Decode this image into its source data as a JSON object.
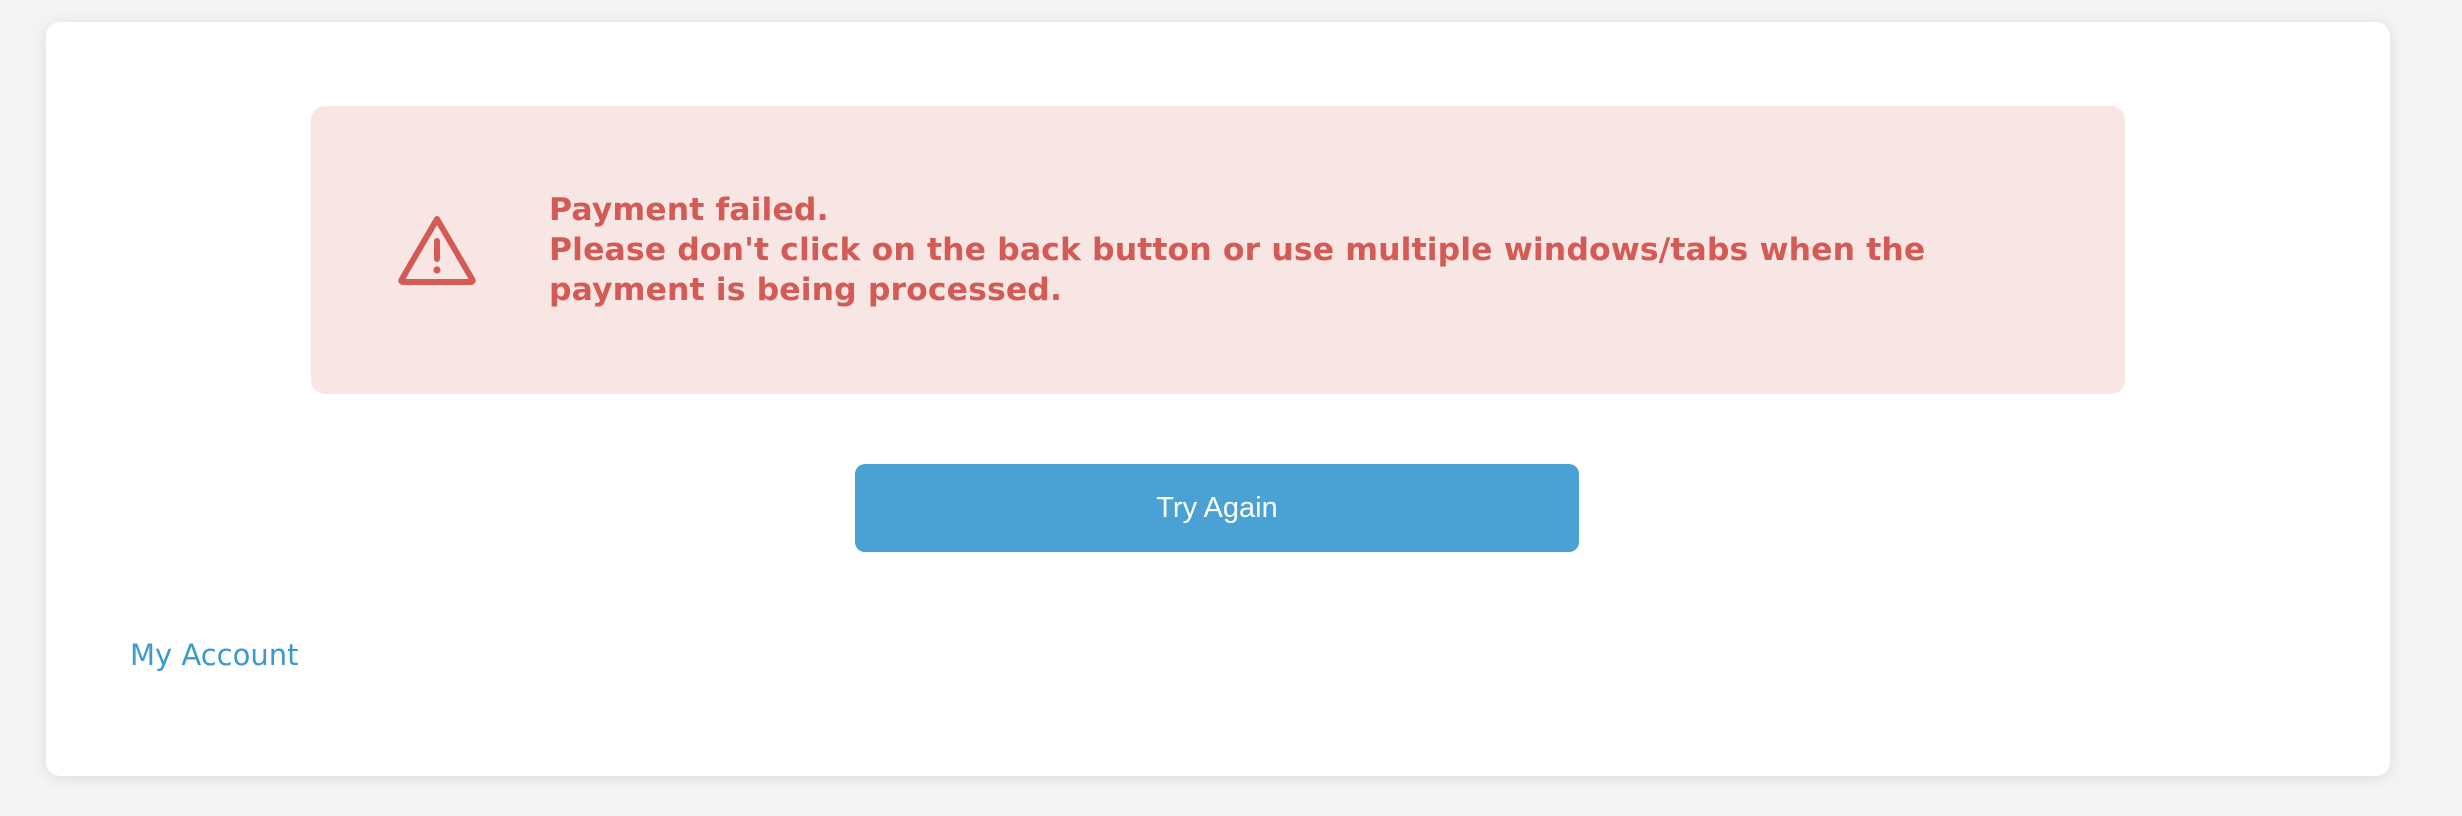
{
  "alert": {
    "icon": "warning-triangle-icon",
    "title": "Payment failed.",
    "message": "Please don't click on the back button or use multiple windows/tabs when the payment is being processed.",
    "background_color": "#f8e6e4",
    "text_color": "#d35a55"
  },
  "actions": {
    "try_again_label": "Try Again",
    "button_color": "#49a1d4"
  },
  "footer": {
    "my_account_label": "My Account",
    "link_color": "#3a9ad0"
  }
}
